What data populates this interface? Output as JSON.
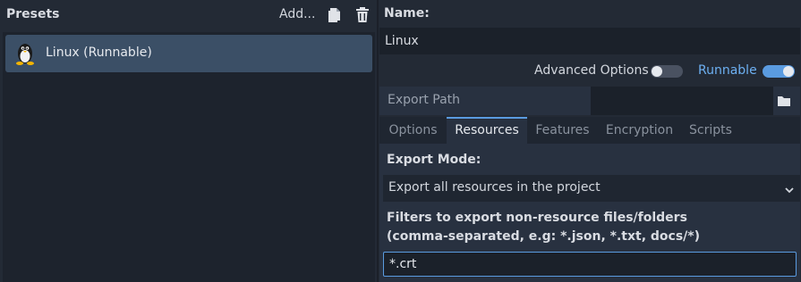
{
  "presets": {
    "title": "Presets",
    "add_label": "Add...",
    "items": [
      {
        "label": "Linux (Runnable)",
        "icon": "linux-tux-icon",
        "selected": true
      }
    ]
  },
  "details": {
    "name_label": "Name:",
    "name_value": "Linux",
    "advanced_options_label": "Advanced Options",
    "advanced_options_on": false,
    "runnable_label": "Runnable",
    "runnable_on": true,
    "export_path_label": "Export Path",
    "export_path_value": ""
  },
  "tabs": [
    {
      "label": "Options",
      "active": false
    },
    {
      "label": "Resources",
      "active": true
    },
    {
      "label": "Features",
      "active": false
    },
    {
      "label": "Encryption",
      "active": false
    },
    {
      "label": "Scripts",
      "active": false
    }
  ],
  "resources": {
    "export_mode_label": "Export Mode:",
    "export_mode_value": "Export all resources in the project",
    "filters_label_line1": "Filters to export non-resource files/folders",
    "filters_label_line2": "(comma-separated, e.g: *.json, *.txt, docs/*)",
    "filters_value": "*.crt"
  },
  "colors": {
    "accent": "#5a9be0",
    "runnable_text": "#6db0f2",
    "selected_item": "#3b4f66",
    "background": "#232a35"
  }
}
